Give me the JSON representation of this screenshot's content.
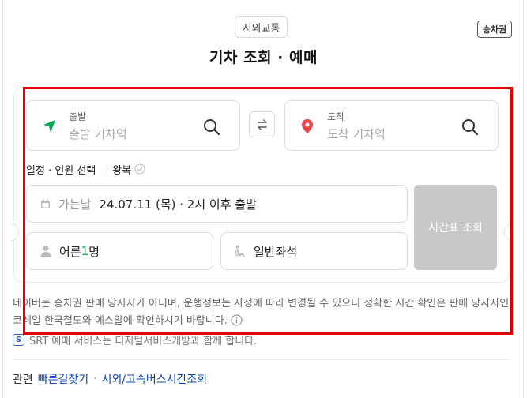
{
  "header": {
    "category_label": "시외교통",
    "badge_label": "승차권",
    "title": "기차 조회 · 예매"
  },
  "departure": {
    "label": "출발",
    "placeholder": "출발 기차역",
    "pin_color": "#03a94d"
  },
  "arrival": {
    "label": "도착",
    "placeholder": "도착 기차역",
    "pin_color": "#f0414c"
  },
  "options": {
    "schedule_label": "일정 · 인원 선택",
    "round_trip_label": "왕복"
  },
  "date_field": {
    "label": "가는날",
    "value": "24.07.11 (목) · 2시 이후 출발"
  },
  "passenger_field": {
    "prefix": "어른",
    "count": "1",
    "suffix": "명"
  },
  "seat_field": {
    "value": "일반좌석"
  },
  "schedule_button": {
    "label": "시간표 조회"
  },
  "notice": {
    "text": "네이버는 승차권 판매 당사자가 아니며, 운행정보는 사정에 따라 변경될 수 있으니 정확한 시간 확인은 판매 당사자인 코레일 한국철도와 에스알에 확인하시기 바랍니다."
  },
  "srt": {
    "logo": "S",
    "text": "SRT 예매 서비스는 디지털서비스개방과 함께 합니다."
  },
  "related": {
    "prefix": "관련",
    "links": [
      "빠른길찾기",
      "시외/고속버스시간조회"
    ]
  },
  "colors": {
    "accent_green": "#03a94d",
    "link_blue": "#0c43b7",
    "highlight_red": "#e50000",
    "disabled_button": "#c8c8c8"
  }
}
